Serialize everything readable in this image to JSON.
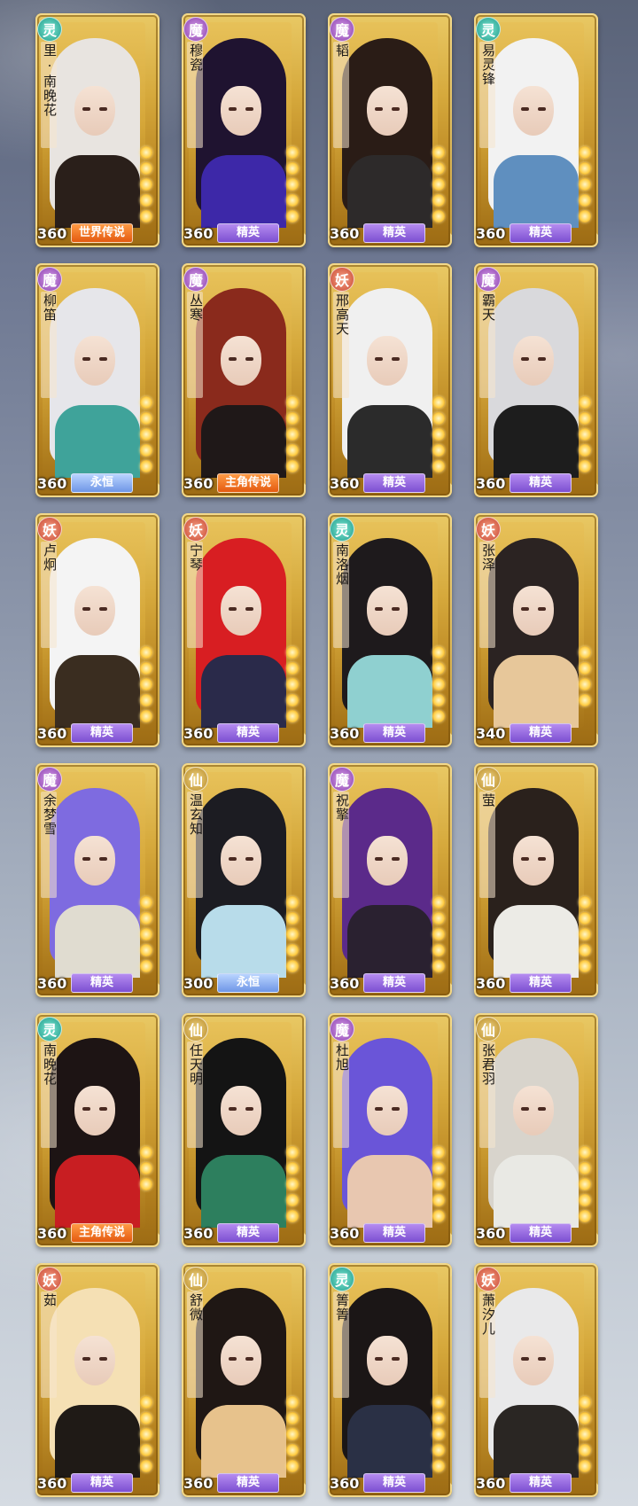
{
  "cards": [
    {
      "name": "里·南晚花",
      "faction": "灵",
      "faction_class": "f-ling",
      "power": "360",
      "rank": "世界传说",
      "rank_class": "r-legend",
      "stars": 5,
      "hair": "#e8e4e0",
      "outfit": "#2a1f1a"
    },
    {
      "name": "穆瓷",
      "faction": "魔",
      "faction_class": "f-mo",
      "power": "360",
      "rank": "精英",
      "rank_class": "r-elite",
      "stars": 5,
      "hair": "#1f1330",
      "outfit": "#3d28a8"
    },
    {
      "name": "韬",
      "faction": "魔",
      "faction_class": "f-mo",
      "power": "360",
      "rank": "精英",
      "rank_class": "r-elite",
      "stars": 5,
      "hair": "#2a1c16",
      "outfit": "#2d2a2a"
    },
    {
      "name": "易灵锋",
      "faction": "灵",
      "faction_class": "f-ling",
      "power": "360",
      "rank": "精英",
      "rank_class": "r-elite",
      "stars": 5,
      "hair": "#f2f2f2",
      "outfit": "#5f8fbf"
    },
    {
      "name": "柳笛",
      "faction": "魔",
      "faction_class": "f-mo",
      "power": "360",
      "rank": "永恒",
      "rank_class": "r-eternal",
      "stars": 5,
      "hair": "#e6e6ea",
      "outfit": "#3fa39a"
    },
    {
      "name": "丛寒",
      "faction": "魔",
      "faction_class": "f-mo",
      "power": "360",
      "rank": "主角传说",
      "rank_class": "r-legend",
      "stars": 5,
      "hair": "#8a2a1c",
      "outfit": "#1f1818"
    },
    {
      "name": "邢高天",
      "faction": "妖",
      "faction_class": "f-yao",
      "power": "360",
      "rank": "精英",
      "rank_class": "r-elite",
      "stars": 5,
      "hair": "#f0f0f0",
      "outfit": "#2b2b2b"
    },
    {
      "name": "霸天",
      "faction": "魔",
      "faction_class": "f-mo",
      "power": "360",
      "rank": "精英",
      "rank_class": "r-elite",
      "stars": 5,
      "hair": "#d9d9dc",
      "outfit": "#1d1d1d"
    },
    {
      "name": "卢炯",
      "faction": "妖",
      "faction_class": "f-yao",
      "power": "360",
      "rank": "精英",
      "rank_class": "r-elite",
      "stars": 5,
      "hair": "#f4f4f4",
      "outfit": "#3a2d20"
    },
    {
      "name": "宁琴",
      "faction": "妖",
      "faction_class": "f-yao",
      "power": "360",
      "rank": "精英",
      "rank_class": "r-elite",
      "stars": 5,
      "hair": "#d81e22",
      "outfit": "#2a2a4a"
    },
    {
      "name": "南洛烟",
      "faction": "灵",
      "faction_class": "f-ling",
      "power": "360",
      "rank": "精英",
      "rank_class": "r-elite",
      "stars": 5,
      "hair": "#1e1a1c",
      "outfit": "#8fd0d0"
    },
    {
      "name": "张泽",
      "faction": "妖",
      "faction_class": "f-yao",
      "power": "340",
      "rank": "精英",
      "rank_class": "r-elite",
      "stars": 4,
      "hair": "#2b2322",
      "outfit": "#e7c79a"
    },
    {
      "name": "余梦雪",
      "faction": "魔",
      "faction_class": "f-mo",
      "power": "360",
      "rank": "精英",
      "rank_class": "r-elite",
      "stars": 5,
      "hair": "#7e6be0",
      "outfit": "#e0dcd0"
    },
    {
      "name": "温玄知",
      "faction": "仙",
      "faction_class": "f-xian",
      "power": "300",
      "rank": "永恒",
      "rank_class": "r-eternal",
      "stars": 5,
      "hair": "#1c1c22",
      "outfit": "#b8dcea"
    },
    {
      "name": "祝擎",
      "faction": "魔",
      "faction_class": "f-mo",
      "power": "360",
      "rank": "精英",
      "rank_class": "r-elite",
      "stars": 5,
      "hair": "#5b2a8a",
      "outfit": "#2a2130"
    },
    {
      "name": "萤",
      "faction": "仙",
      "faction_class": "f-xian",
      "power": "360",
      "rank": "精英",
      "rank_class": "r-elite",
      "stars": 5,
      "hair": "#2a211c",
      "outfit": "#ecebe6"
    },
    {
      "name": "南晚花",
      "faction": "灵",
      "faction_class": "f-ling",
      "power": "360",
      "rank": "主角传说",
      "rank_class": "r-legend",
      "stars": 3,
      "hair": "#1d1414",
      "outfit": "#c81e22"
    },
    {
      "name": "任天明",
      "faction": "仙",
      "faction_class": "f-xian",
      "power": "360",
      "rank": "精英",
      "rank_class": "r-elite",
      "stars": 5,
      "hair": "#141414",
      "outfit": "#2d7f5e"
    },
    {
      "name": "杜旭",
      "faction": "魔",
      "faction_class": "f-mo",
      "power": "360",
      "rank": "精英",
      "rank_class": "r-elite",
      "stars": 5,
      "hair": "#6a55d8",
      "outfit": "#e8c7b0"
    },
    {
      "name": "张君羽",
      "faction": "仙",
      "faction_class": "f-xian",
      "power": "360",
      "rank": "精英",
      "rank_class": "r-elite",
      "stars": 5,
      "hair": "#d8d4cc",
      "outfit": "#e9e9e4"
    },
    {
      "name": "茹",
      "faction": "妖",
      "faction_class": "f-yao",
      "power": "360",
      "rank": "精英",
      "rank_class": "r-elite",
      "stars": 5,
      "hair": "#f5e0b4",
      "outfit": "#1f1a16"
    },
    {
      "name": "舒微",
      "faction": "仙",
      "faction_class": "f-xian",
      "power": "360",
      "rank": "精英",
      "rank_class": "r-elite",
      "stars": 5,
      "hair": "#1f1714",
      "outfit": "#e7c28c"
    },
    {
      "name": "箐箐",
      "faction": "灵",
      "faction_class": "f-ling",
      "power": "360",
      "rank": "精英",
      "rank_class": "r-elite",
      "stars": 5,
      "hair": "#1b1616",
      "outfit": "#2a3045"
    },
    {
      "name": "萧汐儿",
      "faction": "妖",
      "faction_class": "f-yao",
      "power": "360",
      "rank": "精英",
      "rank_class": "r-elite",
      "stars": 5,
      "hair": "#e9e9ea",
      "outfit": "#2a2623"
    }
  ]
}
